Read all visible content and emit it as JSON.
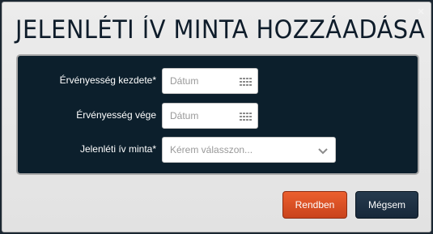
{
  "dialog": {
    "title": "JELENLÉTI ÍV MINTA HOZZÁADÁSA"
  },
  "form": {
    "start": {
      "label": "Érvényesség kezdete*",
      "placeholder": "Dátum"
    },
    "end": {
      "label": "Érvényesség vége",
      "placeholder": "Dátum"
    },
    "template": {
      "label": "Jelenléti ív minta*",
      "placeholder": "Kérem válasszon..."
    }
  },
  "buttons": {
    "ok_label": "Rendben",
    "cancel_label": "Mégsem"
  },
  "icons": {
    "close": "close-icon",
    "calendar": "calendar-icon",
    "dropdown": "chevron-down-icon"
  },
  "colors": {
    "ok_button": "#d9501f",
    "cancel_button": "#1e3144",
    "panel": "#0c1f2c"
  }
}
